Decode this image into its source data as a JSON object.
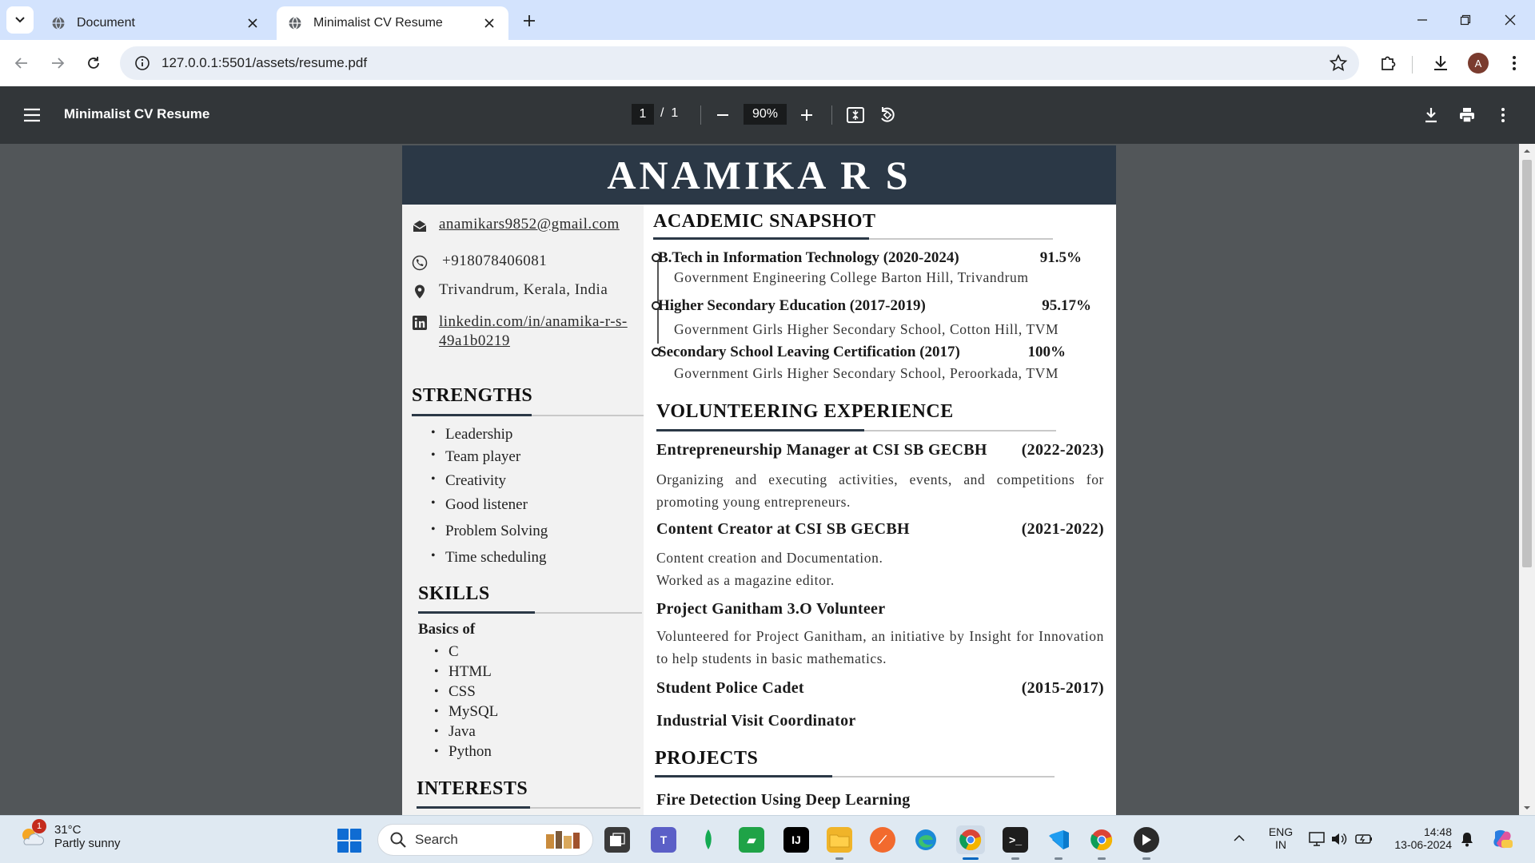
{
  "browser": {
    "tabs": [
      {
        "title": "Document",
        "active": false
      },
      {
        "title": "Minimalist CV Resume",
        "active": true
      }
    ],
    "url": "127.0.0.1:5501/assets/resume.pdf",
    "profile_initial": "A"
  },
  "pdf_viewer": {
    "title": "Minimalist CV Resume",
    "current_page": "1",
    "page_separator": "/",
    "total_pages": "1",
    "zoom": "90%"
  },
  "resume": {
    "name": "ANAMIKA R S",
    "contact": {
      "email": "anamikars9852@gmail.com",
      "phone": "+918078406081",
      "location": "Trivandrum, Kerala, India",
      "linkedin_line1": "linkedin.com/in/anamika-r-s-",
      "linkedin_line2": "49a1b0219"
    },
    "strengths": {
      "title": "STRENGTHS",
      "items": [
        "Leadership",
        "Team player",
        "Creativity",
        "Good listener",
        "Problem Solving",
        "Time scheduling"
      ]
    },
    "skills": {
      "title": "SKILLS",
      "subtitle": "Basics of",
      "items": [
        "C",
        "HTML",
        "CSS",
        "MySQL",
        "Java",
        "Python"
      ]
    },
    "interests": {
      "title": "INTERESTS"
    },
    "academic": {
      "title": "ACADEMIC SNAPSHOT",
      "items": [
        {
          "degree": "B.Tech in Information Technology (2020-2024)",
          "score": "91.5%",
          "school": "Government Engineering College Barton Hill, Trivandrum"
        },
        {
          "degree": "Higher Secondary Education (2017-2019)",
          "score": "95.17%",
          "school": "Government Girls Higher Secondary School, Cotton Hill, TVM"
        },
        {
          "degree": "Secondary School Leaving Certification (2017)",
          "score": "100%",
          "school": "Government Girls Higher Secondary School, Peroorkada, TVM"
        }
      ]
    },
    "volunteering": {
      "title": "VOLUNTEERING EXPERIENCE",
      "items": [
        {
          "role": "Entrepreneurship Manager at CSI SB GECBH",
          "period": "(2022-2023)",
          "desc": "Organizing and executing activities, events, and competitions for promoting young entrepreneurs."
        },
        {
          "role": "Content Creator at CSI SB GECBH",
          "period": "(2021-2022)",
          "desc_line1": "Content creation and Documentation.",
          "desc_line2": "Worked as a magazine editor."
        },
        {
          "role": "Project Ganitham 3.O Volunteer",
          "period": "",
          "desc": "Volunteered for Project Ganitham, an initiative by Insight for Innovation to help students in basic mathematics."
        },
        {
          "role": "Student Police Cadet",
          "period": "(2015-2017)"
        },
        {
          "role": "Industrial Visit Coordinator",
          "period": ""
        }
      ]
    },
    "projects": {
      "title": "PROJECTS",
      "items": [
        "Fire Detection Using Deep Learning"
      ]
    }
  },
  "taskbar": {
    "weather_temp": "31°C",
    "weather_desc": "Partly sunny",
    "weather_badge": "1",
    "search_placeholder": "Search",
    "lang_line1": "ENG",
    "lang_line2": "IN",
    "time": "14:48",
    "date": "13-06-2024"
  }
}
